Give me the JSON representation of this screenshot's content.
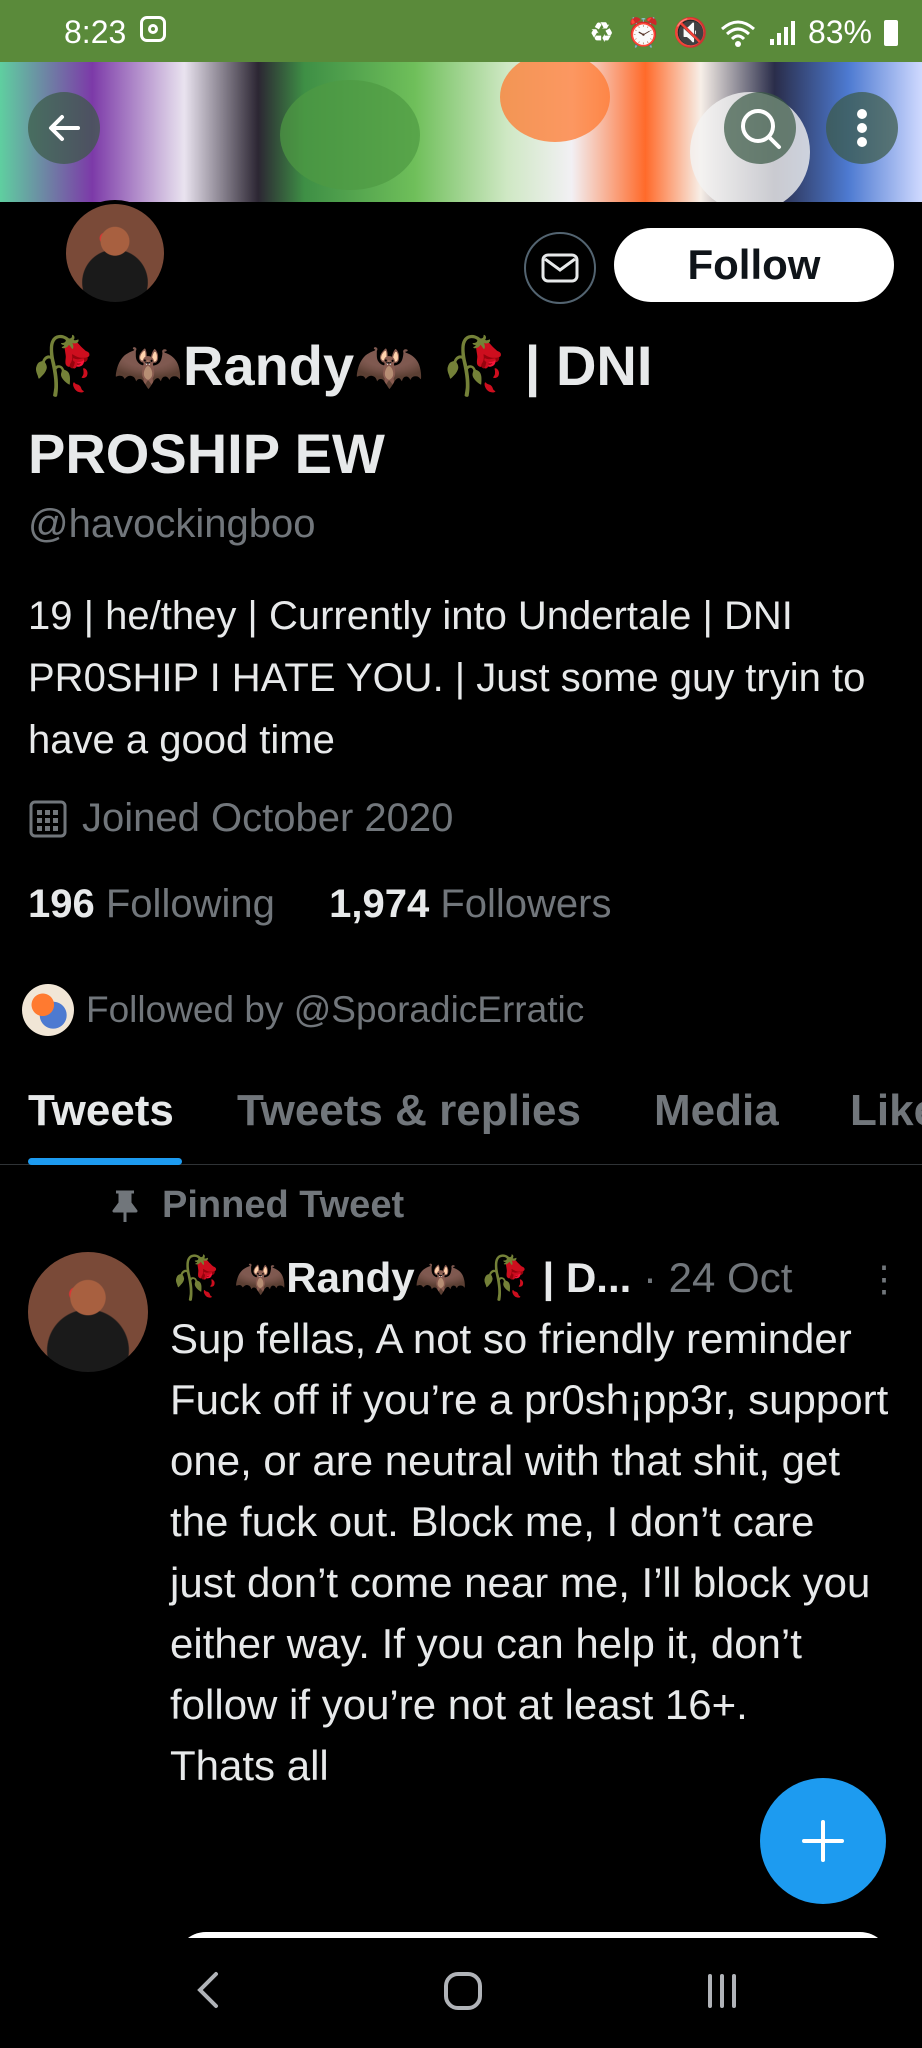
{
  "status_bar": {
    "time": "8:23",
    "battery": "83%",
    "icons": [
      "camera-icon",
      "battery-saver-icon",
      "alarm-icon",
      "mute-icon",
      "wifi-icon",
      "signal-icon",
      "battery-icon"
    ]
  },
  "header": {
    "back_icon": "arrow-left-icon",
    "search_icon": "search-icon",
    "more_icon": "more-vertical-icon"
  },
  "profile": {
    "mail_icon": "mail-icon",
    "follow_label": "Follow",
    "name_line1": "🥀 🦇Randy🦇 🥀 | DNI",
    "name_line2": "PROSHIP EW",
    "handle": "@havockingboo",
    "bio": "19 | he/they | Currently into Undertale | DNI PR0SHIP I HATE YOU. | Just some guy tryin to have a good time",
    "joined": "Joined October 2020",
    "following_count": "196",
    "following_label": "Following",
    "followers_count": "1,974",
    "followers_label": "Followers",
    "followed_by": "Followed by @SporadicErratic"
  },
  "tabs": [
    {
      "label": "Tweets",
      "active": true
    },
    {
      "label": "Tweets & replies",
      "active": false
    },
    {
      "label": "Media",
      "active": false
    },
    {
      "label": "Like",
      "active": false
    }
  ],
  "pinned_tweet": {
    "pinned_label": "Pinned Tweet",
    "author": "🥀 🦇Randy🦇 🥀 | D...",
    "date": "· 24 Oct",
    "more": "⋮",
    "text": "Sup fellas, A not so friendly reminder\nFuck off if you’re a pr0sh¡pp3r, support one, or are neutral with that shit, get the fuck out. Block me, I don’t care just don’t come near me, I’ll block you either way. If you can help it, don’t follow if you’re not at least 16+.\nThats all"
  },
  "fab_icon": "plus-icon",
  "nav": [
    "back-nav-icon",
    "home-nav-icon",
    "recents-nav-icon"
  ],
  "colors": {
    "accent": "#1d9bf0",
    "status_bar": "#5a8a3a",
    "background": "#000000"
  }
}
